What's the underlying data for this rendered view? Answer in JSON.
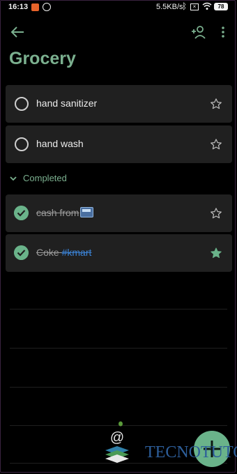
{
  "status_bar": {
    "time": "16:13",
    "network_speed": "5.5KB/s",
    "battery": "78"
  },
  "toolbar": {
    "back_icon": "arrow-back-icon",
    "share_icon": "add-person-icon",
    "more_icon": "more-vert-icon"
  },
  "list": {
    "title": "Grocery"
  },
  "tasks": [
    {
      "label": "hand sanitizer",
      "completed": false,
      "starred": false
    },
    {
      "label": "hand wash",
      "completed": false,
      "starred": false
    }
  ],
  "completed_section": {
    "label": "Completed",
    "tasks": [
      {
        "label": "cash from",
        "emoji": "atm-icon",
        "completed": true,
        "starred": false
      },
      {
        "label": "Coke",
        "hashtag": "#kmart",
        "completed": true,
        "starred": true
      }
    ]
  },
  "watermark": {
    "text": "TECNOTUTO"
  },
  "fab": {
    "icon": "plus-icon"
  },
  "colors": {
    "accent": "#7bb08f",
    "check_done": "#6ab38a",
    "hashtag": "#3b83d6",
    "card_bg": "#202020",
    "background": "#000000"
  }
}
